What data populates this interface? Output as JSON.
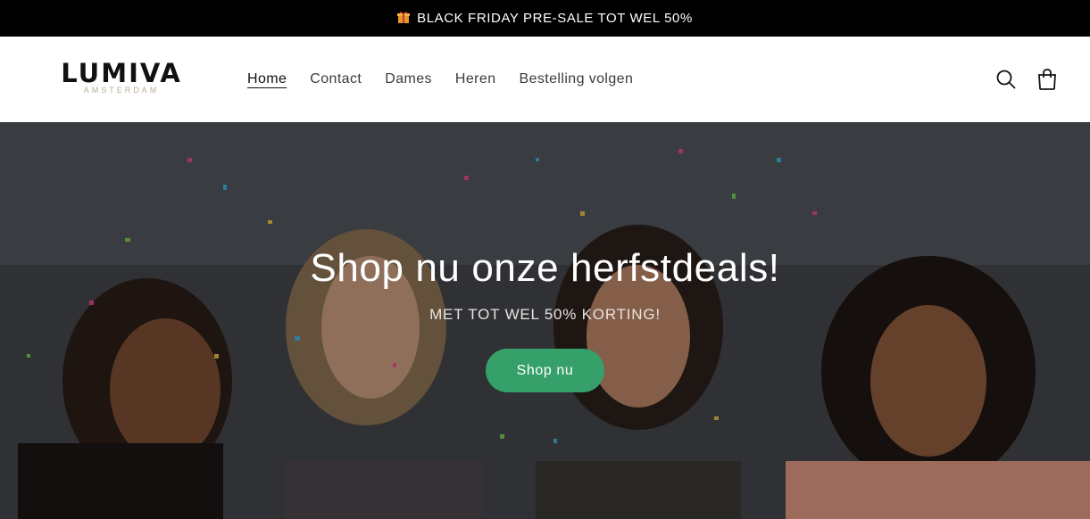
{
  "announcement": {
    "icon": "gift-icon",
    "text": "BLACK FRIDAY PRE-SALE TOT WEL 50%"
  },
  "header": {
    "logo_main": "LUMIVA",
    "logo_sub": "AMSTERDAM",
    "nav": [
      {
        "label": "Home",
        "active": true
      },
      {
        "label": "Contact"
      },
      {
        "label": "Dames"
      },
      {
        "label": "Heren"
      },
      {
        "label": "Bestelling volgen"
      }
    ],
    "icons": [
      "search-icon",
      "cart-icon"
    ]
  },
  "hero": {
    "title": "Shop nu onze herfstdeals!",
    "subtitle": "MET TOT WEL 50% KORTING!",
    "button_label": "Shop nu",
    "button_color": "#36a06a",
    "image": "photo of four laughing women with confetti"
  },
  "colors": {
    "announcement_bg": "#000000",
    "gift": "#f0a030",
    "logo_sub": "#b9ae98"
  }
}
